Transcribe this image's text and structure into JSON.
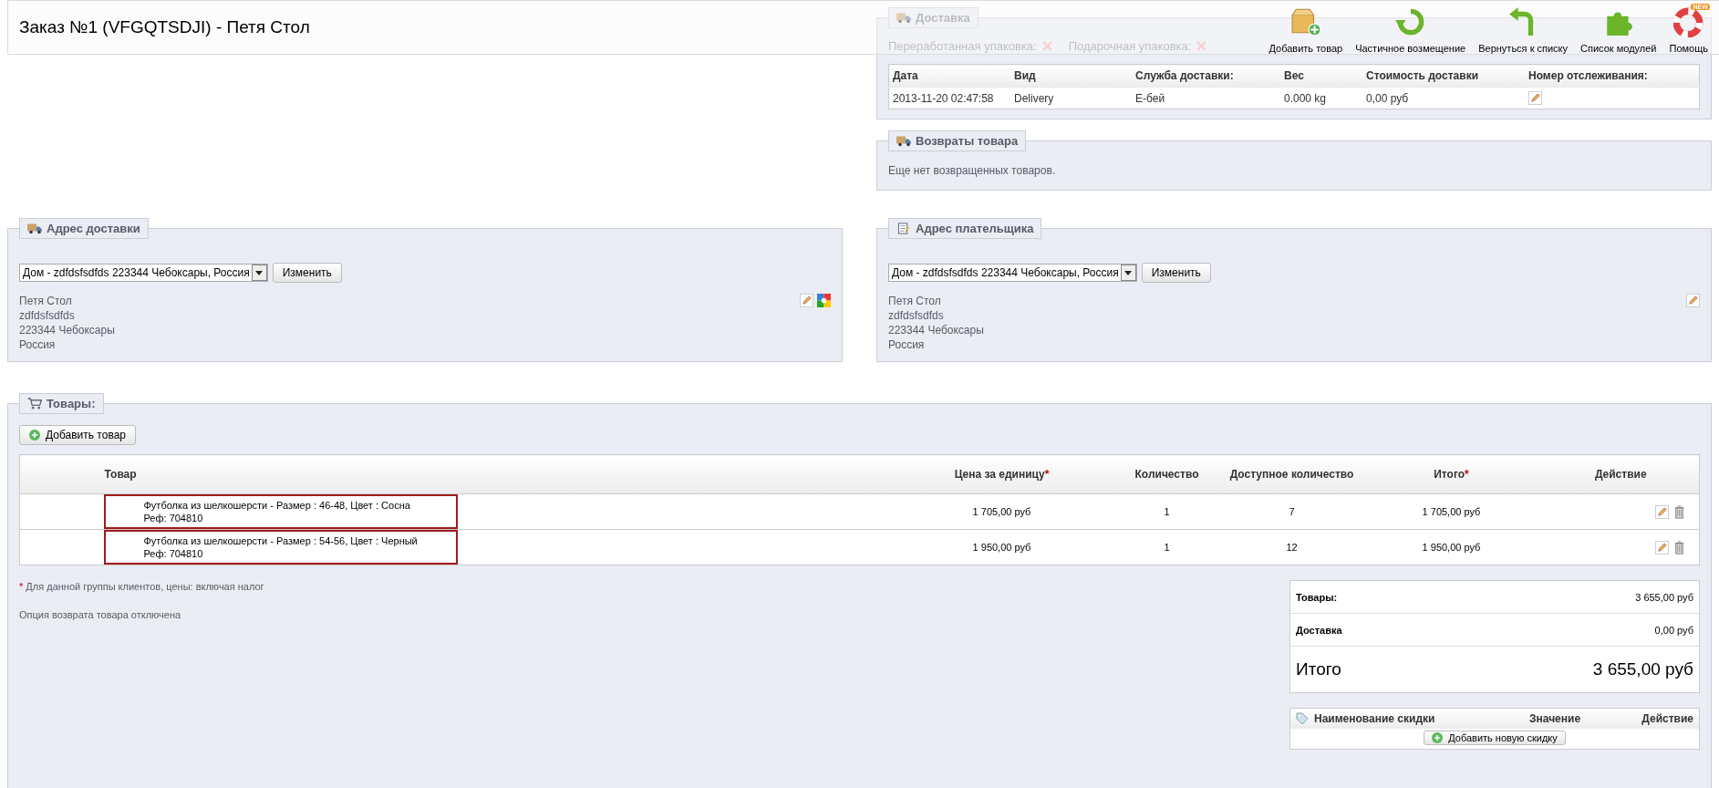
{
  "header": {
    "title": "Заказ №1 (VFGQTSDJI) - Петя Стол",
    "toolbar": [
      {
        "kind": "box-add",
        "label": "Добавить товар"
      },
      {
        "kind": "refund",
        "label": "Частичное возмещение"
      },
      {
        "kind": "back",
        "label": "Вернуться к списку"
      },
      {
        "kind": "modules",
        "label": "Список модулей"
      },
      {
        "kind": "help",
        "label": "Помощь",
        "badge": "NEW"
      }
    ]
  },
  "shipping": {
    "legend": "Доставка",
    "options": [
      {
        "label": "Переработанная упаковка:",
        "on": false
      },
      {
        "label": "Подарочная упаковка:",
        "on": false
      }
    ],
    "columns": [
      "Дата",
      "Вид",
      "Служба доставки:",
      "Вес",
      "Стоимость доставки",
      "Номер отслеживания:"
    ],
    "rows": [
      {
        "cells": [
          "2013-11-20 02:47:58",
          "Delivery",
          "Е-бей",
          "0.000 kg",
          "0,00 руб"
        ],
        "editable": true
      }
    ]
  },
  "returns": {
    "legend": "Возвраты товара",
    "message": "Еще нет возвращенных товаров."
  },
  "addresses": [
    {
      "kind": "shipping",
      "legend": "Адрес доставки",
      "select": "Дом - zdfdsfsdfds 223344 Чебоксары, Россия",
      "button": "Изменить",
      "lines": [
        "Петя Стол",
        "zdfdsfsdfds",
        "223344 Чебоксары",
        "Россия"
      ],
      "map": true
    },
    {
      "kind": "billing",
      "legend": "Адрес плательщика",
      "select": "Дом - zdfdsfsdfds 223344 Чебоксары, Россия",
      "button": "Изменить",
      "lines": [
        "Петя Стол",
        "zdfdsfsdfds",
        "223344 Чебоксары",
        "Россия"
      ],
      "map": false
    }
  ],
  "products": {
    "legend": "Товары:",
    "add_button": "Добавить товар",
    "columns": [
      {
        "label": "Товар"
      },
      {
        "label": "Цена за единицу",
        "mark": "*"
      },
      {
        "label": "Количество"
      },
      {
        "label": "Доступное количество"
      },
      {
        "label": "Итого",
        "mark": "*"
      },
      {
        "label": "Действие"
      }
    ],
    "rows": [
      {
        "name": "Футболка из шелкошерсти - Размер : 46-48, Цвет : Сосна",
        "ref": "Реф: 704810",
        "price": "1 705,00 руб",
        "qty": "1",
        "available": "7",
        "total": "1 705,00 руб",
        "outlined": true
      },
      {
        "name": "Футболка из шелкошерсти - Размер : 54-56, Цвет : Черный",
        "ref": "Реф: 704810",
        "price": "1 950,00 руб",
        "qty": "1",
        "available": "12",
        "total": "1 950,00 руб",
        "outlined": true
      }
    ],
    "note_mark": "*",
    "note": "Для данной группы клиентов, цены: включая налог",
    "return_note": "Опция возврата товара отключена",
    "totals": [
      {
        "kind": "line",
        "label": "Товары:",
        "value": "3 655,00 руб"
      },
      {
        "kind": "line",
        "label": "Доставка",
        "value": "0,00 руб"
      },
      {
        "kind": "grand",
        "label": "Итого",
        "value": "3 655,00 руб"
      }
    ],
    "discounts": {
      "columns": [
        "Наименование скидки",
        "Значение",
        "Действие"
      ],
      "button": "Добавить новую скидку"
    }
  }
}
